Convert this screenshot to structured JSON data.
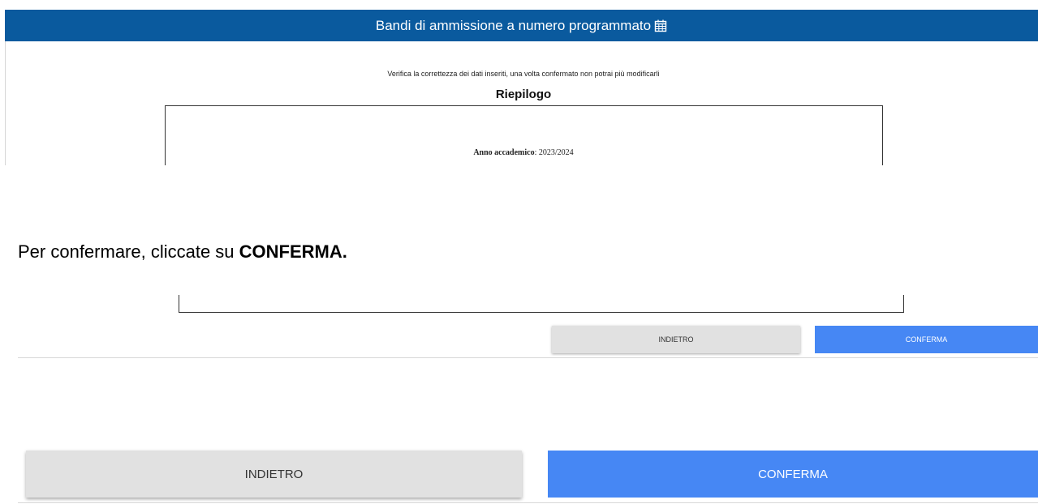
{
  "header": {
    "title": "Bandi di ammissione a numero programmato",
    "icon": "calendar-icon",
    "background": "#0a5a9e"
  },
  "summary": {
    "notice": "Verifica la correttezza dei dati inseriti, una volta confermato non potrai più modificarli",
    "title": "Riepilogo",
    "anno_label": "Anno accademico",
    "anno_value": ": 2023/2024"
  },
  "instruction": {
    "text": "Per confermare, cliccate su ",
    "highlight": "CONFERMA."
  },
  "buttons": {
    "back_label": "INDIETRO",
    "confirm_label": "CONFERMA",
    "back_color": "#e1e1e1",
    "confirm_color": "#4687f4"
  }
}
